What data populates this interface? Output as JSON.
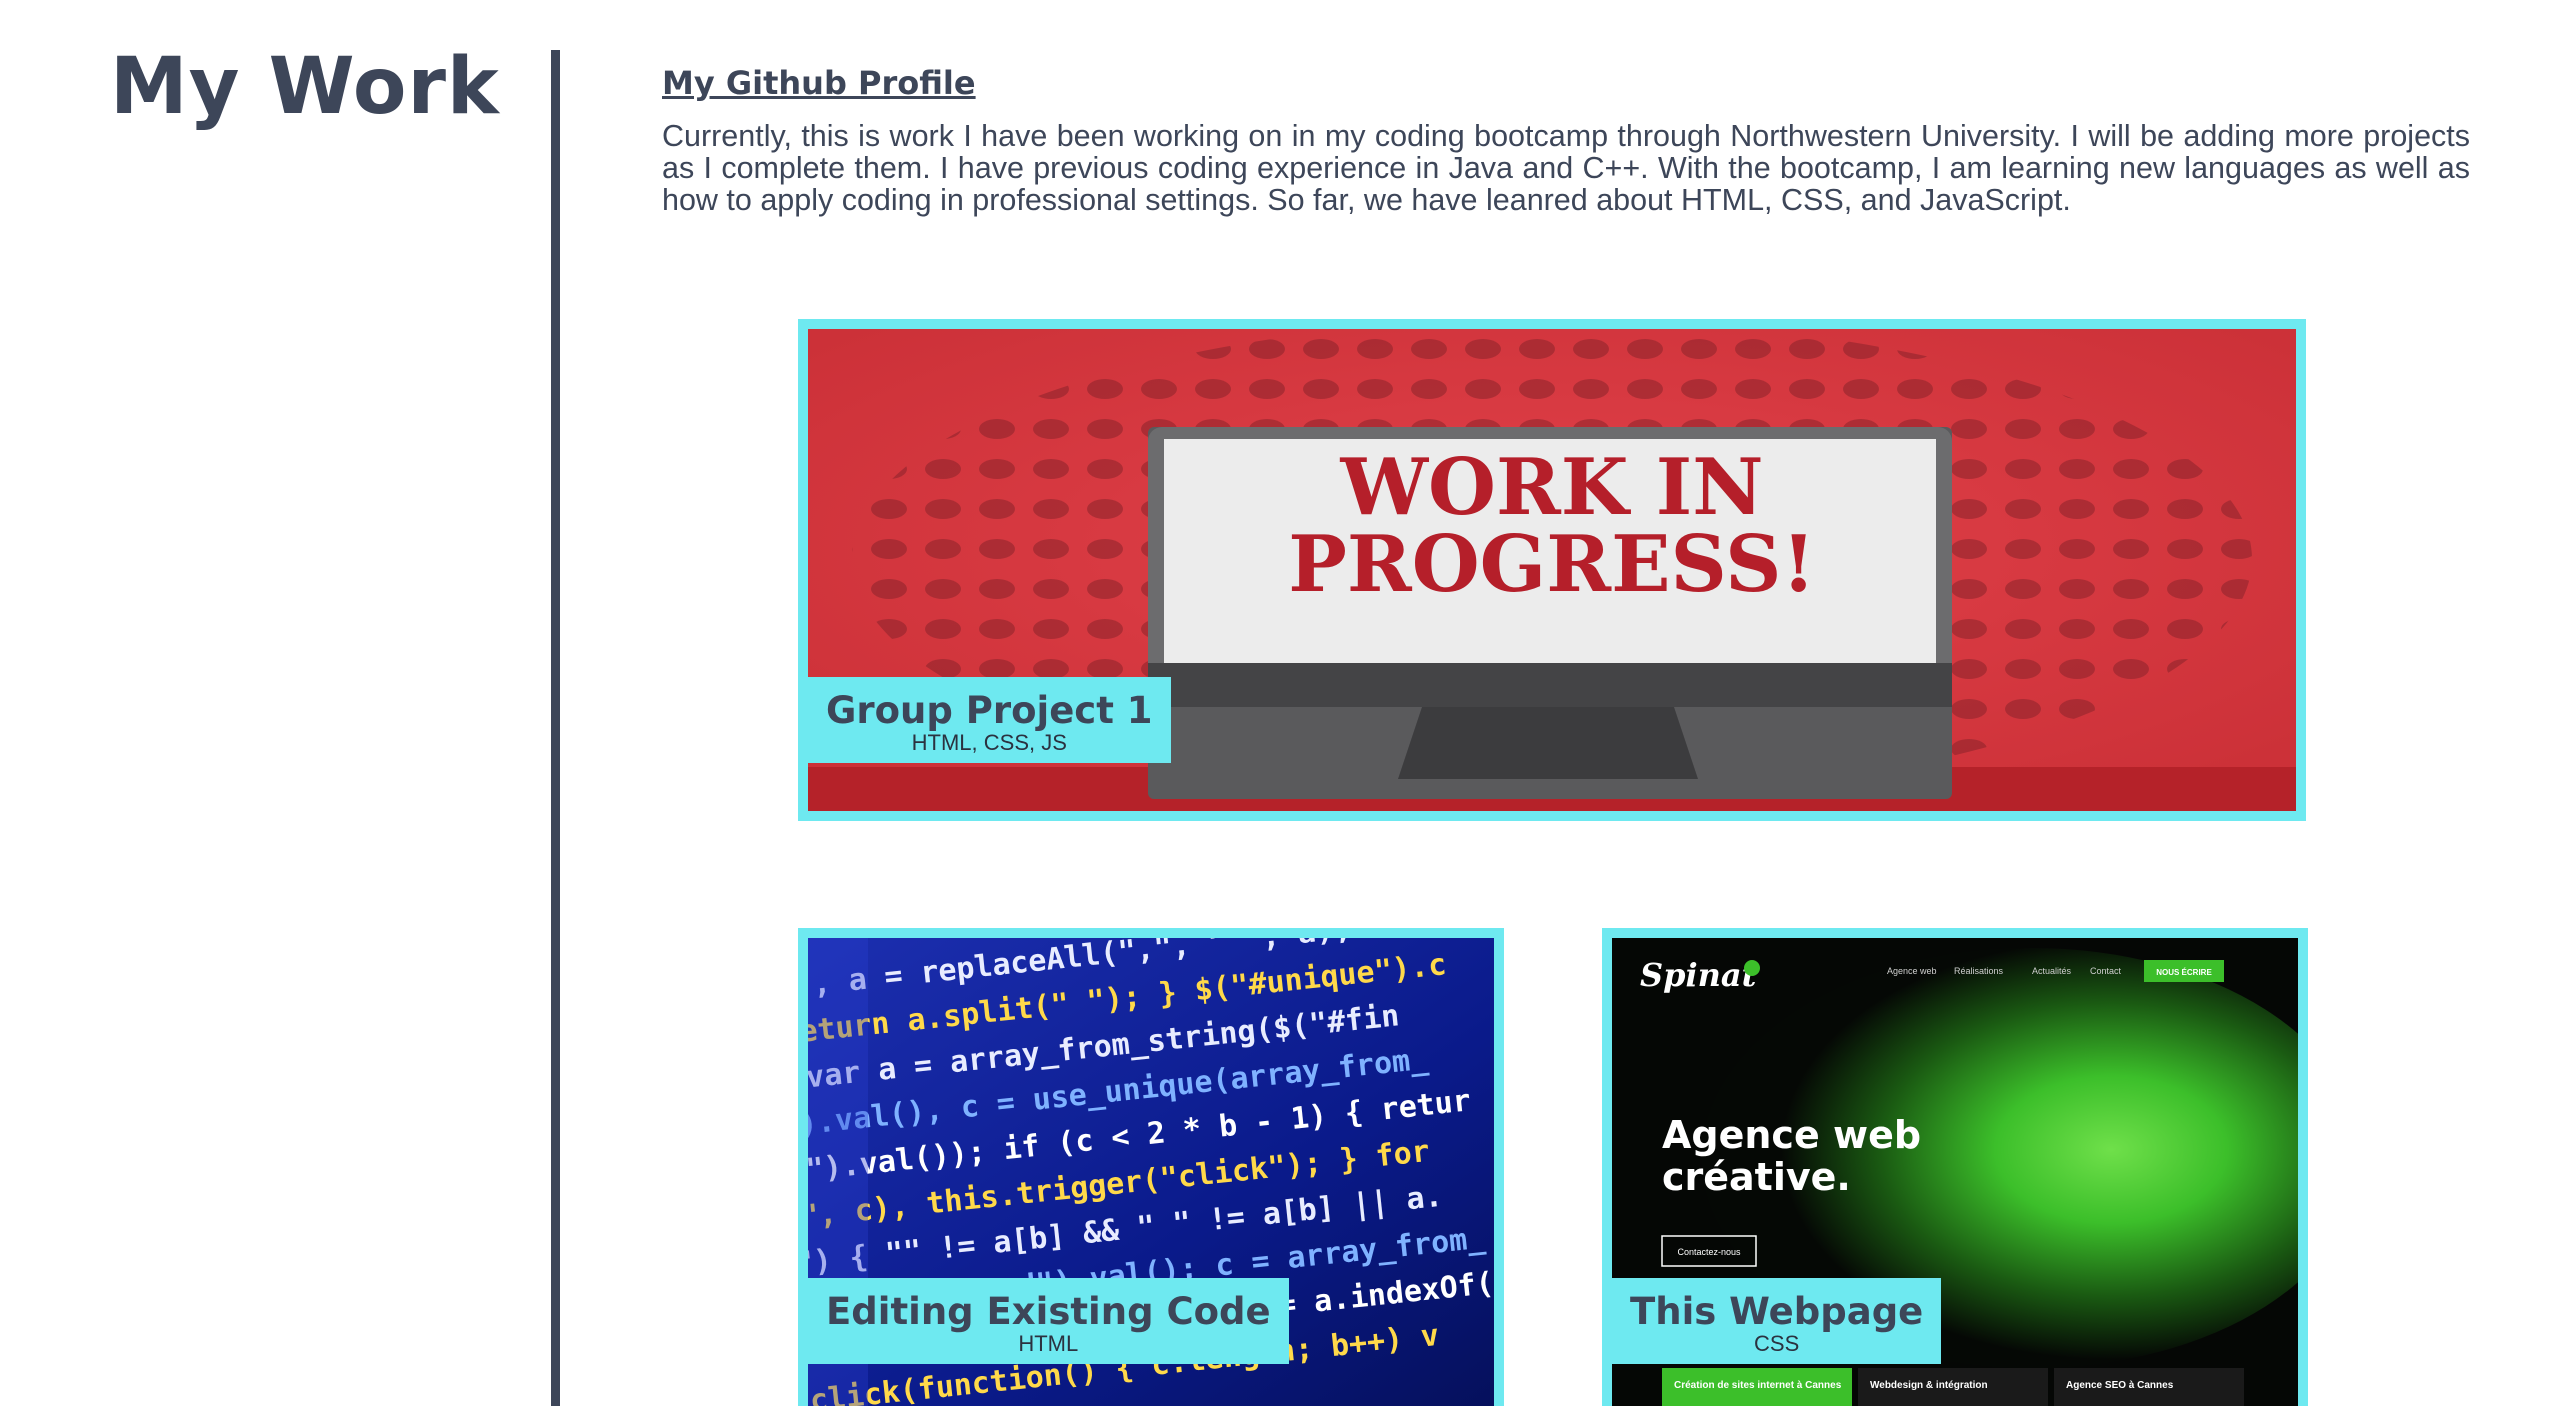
{
  "page": {
    "title": "My Work"
  },
  "intro": {
    "link_label": "My Github Profile",
    "text": "Currently, this is work I have been working on in my coding bootcamp through Northwestern University. I will be adding more projects as I complete them. I have previous coding experience in Java and C++. With the bootcamp, I am learning new languages as well as how to apply coding in professional settings. So far, we have leanred about HTML, CSS, and JavaScript."
  },
  "projects": [
    {
      "title": "Group Project 1",
      "tech": "HTML, CSS, JS",
      "image_text": [
        "WORK IN",
        "PROGRESS!"
      ]
    },
    {
      "title": "Editing Existing Code",
      "tech": "HTML",
      "image_code_lines": [
        "\"), a = replaceAll(\",\", \" \", a); a = a.repl",
        "return a.split(\" \"); } $(\"#unique\").c",
        "var a = array_from_string($(\"#fin",
        "\").val(), c = use_unique(array_from_",
        "\").val()); if (c < 2 * b - 1) { retur",
        "\", c), this.trigger(\"click\"); } for",
        "\") { \"\" != a[b] && \" \" != a[b] || a.",
        "\"user_logged\").val(); c = array_from_",
        "for (c.length; b++) { != a.indexOf(c",
        "click(function() { c.length; b++) v"
      ]
    },
    {
      "title": "This Webpage",
      "tech": "CSS",
      "image_logo": "Spinat",
      "image_headline": [
        "Agence web",
        "créative."
      ],
      "image_nav": [
        "Agence web",
        "Réalisations",
        "Actualités",
        "Contact"
      ],
      "image_cta": "NOUS ÉCRIRE",
      "image_button": "Contactez-nous",
      "image_footer": [
        "Création de sites internet à Cannes",
        "Webdesign & intégration",
        "Agence SEO à Cannes"
      ]
    }
  ],
  "colors": {
    "accent": "#6ee9f0",
    "heading": "#3d4659",
    "wip_red": "#d1353f",
    "code_bg": "#0a1a8a",
    "web_green": "#3cbf2a"
  }
}
